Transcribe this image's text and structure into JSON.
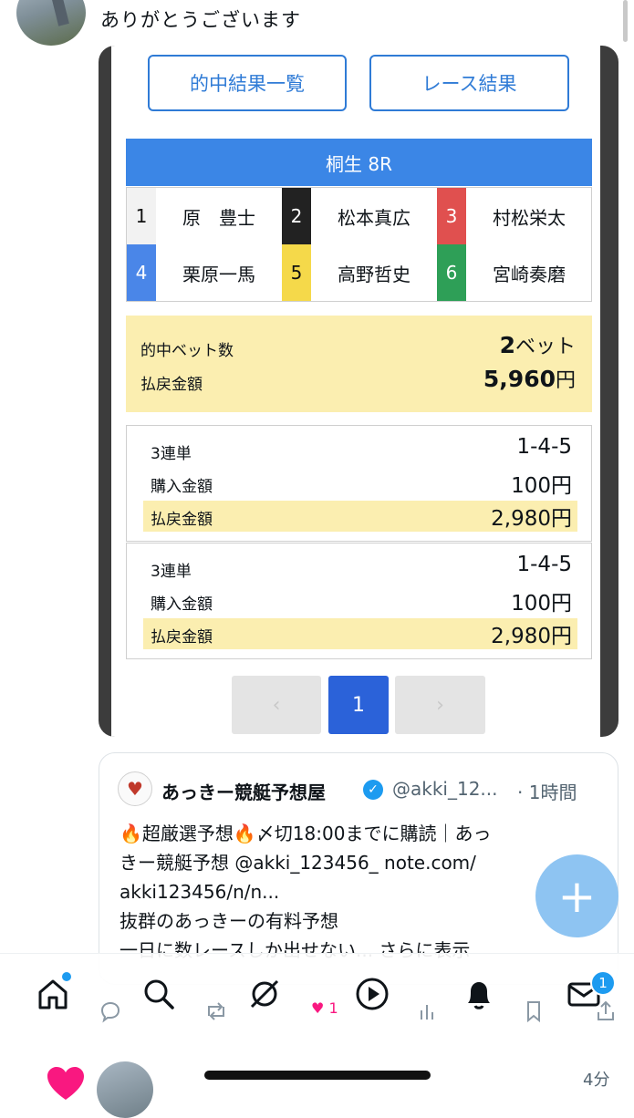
{
  "reply": {
    "text": "ありがとうございます"
  },
  "embed": {
    "buttons": {
      "hits_list": "的中結果一覧",
      "race_results": "レース結果"
    },
    "race": {
      "title": "桐生 8R"
    },
    "racers": [
      {
        "num": "1",
        "name": "原　豊士",
        "color": "#f2f2f2",
        "text_color": "#111111"
      },
      {
        "num": "2",
        "name": "松本真広",
        "color": "#222222",
        "text_color": "#ffffff"
      },
      {
        "num": "3",
        "name": "村松栄太",
        "color": "#e0504f",
        "text_color": "#ffffff"
      },
      {
        "num": "4",
        "name": "栗原一馬",
        "color": "#4a86e8",
        "text_color": "#ffffff"
      },
      {
        "num": "5",
        "name": "高野哲史",
        "color": "#f5d94a",
        "text_color": "#111111"
      },
      {
        "num": "6",
        "name": "宮崎奏磨",
        "color": "#2e9f57",
        "text_color": "#ffffff"
      }
    ],
    "summary": {
      "hit_bets_label": "的中ベット数",
      "hit_bets_value": "2",
      "hit_bets_unit": "ベット",
      "payout_label": "払戻金額",
      "payout_value": "5,960",
      "payout_unit": "円"
    },
    "bets": [
      {
        "type": "3連単",
        "combo": "1-4-5",
        "purchase_label": "購入金額",
        "purchase": "100円",
        "payout_label": "払戻金額",
        "payout": "2,980円"
      },
      {
        "type": "3連単",
        "combo": "1-4-5",
        "purchase_label": "購入金額",
        "purchase": "100円",
        "payout_label": "払戻金額",
        "payout": "2,980円"
      }
    ],
    "pagination": {
      "prev": "‹",
      "current": "1",
      "next": "›"
    }
  },
  "card": {
    "name": "あっきー競艇予想屋",
    "handle": "@akki_12...",
    "time": "· 1時間",
    "lines": [
      "🔥超厳選予想🔥〆切18:00までに購読｜あっ",
      "きー競艇予想 @akki_123456_ note.com/",
      "akki123456/n/n...",
      "抜群のあっきーの有料予想",
      "一日に数レースしか出せない... さらに表示"
    ]
  },
  "fab": {
    "label": "+"
  },
  "tabbar": {
    "like_count": "1",
    "notification_badge": "1"
  },
  "next_tweet": {
    "time": "4分"
  },
  "colors": {
    "accent": "#1d9bf0",
    "race_blue": "#3b86e6",
    "highlight": "#fbeeb0",
    "page_active": "#2b62d9",
    "like": "#f91880"
  }
}
